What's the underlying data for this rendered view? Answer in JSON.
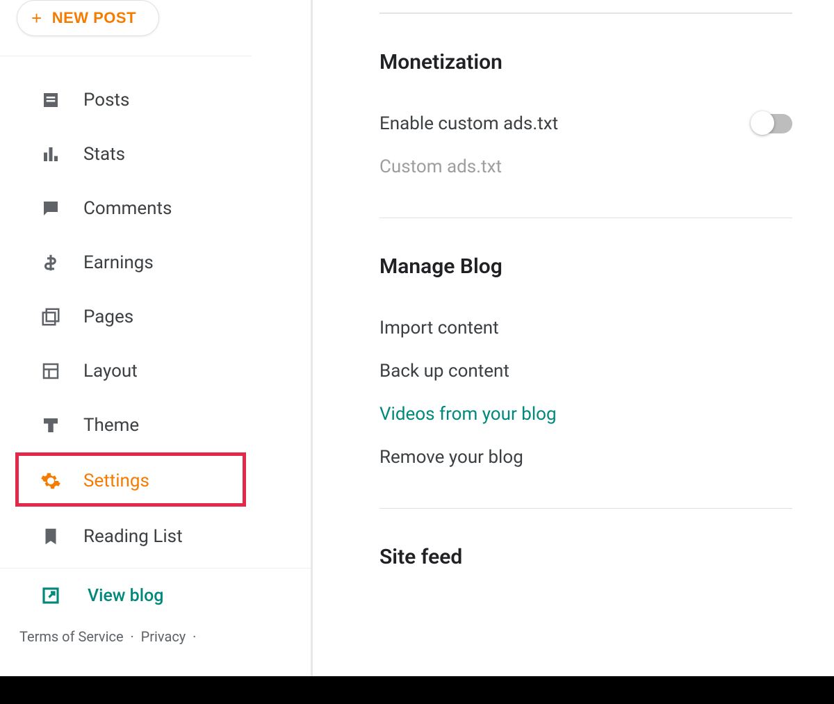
{
  "sidebar": {
    "new_post_label": "NEW POST",
    "items": [
      {
        "id": "posts",
        "label": "Posts"
      },
      {
        "id": "stats",
        "label": "Stats"
      },
      {
        "id": "comments",
        "label": "Comments"
      },
      {
        "id": "earnings",
        "label": "Earnings"
      },
      {
        "id": "pages",
        "label": "Pages"
      },
      {
        "id": "layout",
        "label": "Layout"
      },
      {
        "id": "theme",
        "label": "Theme"
      },
      {
        "id": "settings",
        "label": "Settings"
      },
      {
        "id": "reading-list",
        "label": "Reading List"
      }
    ],
    "view_blog_label": "View blog"
  },
  "footer": {
    "terms": "Terms of Service",
    "privacy": "Privacy"
  },
  "main": {
    "monetization": {
      "title": "Monetization",
      "enable_ads_label": "Enable custom ads.txt",
      "custom_ads_label": "Custom ads.txt"
    },
    "manage_blog": {
      "title": "Manage Blog",
      "import_label": "Import content",
      "backup_label": "Back up content",
      "videos_label": "Videos from your blog",
      "remove_label": "Remove your blog"
    },
    "site_feed": {
      "title": "Site feed"
    }
  }
}
